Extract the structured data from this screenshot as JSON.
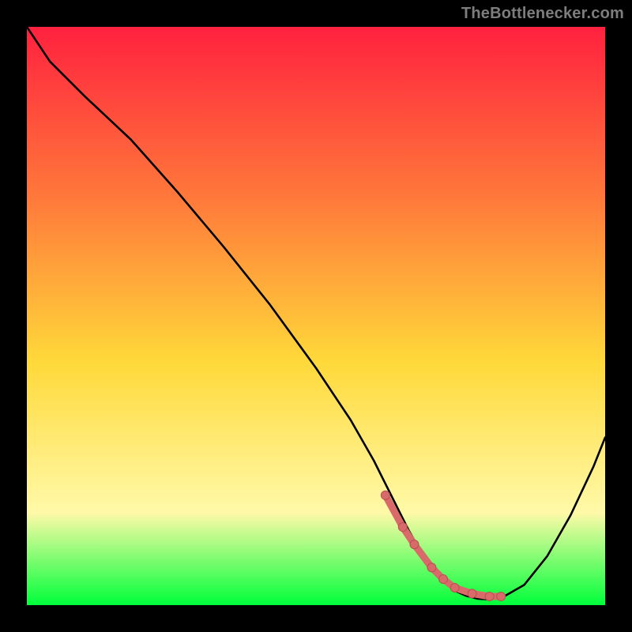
{
  "attribution": "TheBottlenecker.com",
  "colors": {
    "frame_bg": "#000000",
    "gradient_top": "#ff213f",
    "gradient_mid_upper": "#ff7a3a",
    "gradient_mid": "#ffd93a",
    "gradient_lower": "#fff9a8",
    "gradient_bottom": "#00ff3a",
    "curve": "#000000",
    "marker_fill": "#d96a6a",
    "marker_stroke": "#b84f4f"
  },
  "chart_data": {
    "type": "line",
    "title": "",
    "xlabel": "",
    "ylabel": "",
    "xlim": [
      0,
      100
    ],
    "ylim": [
      0,
      100
    ],
    "grid": false,
    "legend": false,
    "x": [
      0,
      4,
      10,
      18,
      26,
      34,
      42,
      50,
      56,
      60,
      62,
      64,
      66,
      68,
      70,
      72,
      74,
      76,
      78,
      80,
      82,
      86,
      90,
      94,
      98,
      100
    ],
    "values": [
      100,
      94,
      88,
      80.5,
      71.5,
      62,
      52,
      41,
      32,
      25,
      21,
      17,
      13,
      9.5,
      6.5,
      4,
      2.5,
      1.6,
      1.1,
      1.0,
      1.2,
      3.5,
      8.5,
      15.5,
      24,
      29
    ],
    "markers": {
      "x": [
        62,
        65,
        67,
        70,
        72,
        74,
        77,
        80,
        82
      ],
      "y": [
        19,
        13.5,
        10.5,
        6.5,
        4.5,
        3,
        2,
        1.5,
        1.5
      ]
    }
  }
}
